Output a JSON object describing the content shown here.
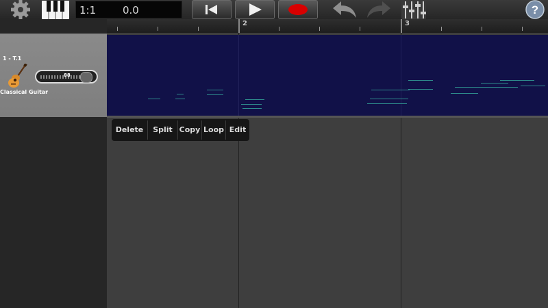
{
  "toolbar": {
    "position": "1:1",
    "time": "0.0",
    "buttons": [
      "settings-icon",
      "piano-keyboard-icon",
      "rewind-icon",
      "play-icon",
      "record-icon",
      "undo-icon",
      "redo-icon",
      "mixer-icon",
      "help-icon"
    ]
  },
  "ruler": {
    "bar_labels": [
      "2",
      "3"
    ]
  },
  "track": {
    "number": "1 - T.1",
    "instrument": "Classical Guitar",
    "instrument_icon": "guitar-icon",
    "volume": "88"
  },
  "context_menu": {
    "items": [
      "Delete",
      "Split",
      "Copy",
      "Loop",
      "Edit"
    ]
  },
  "colors": {
    "clip_background": "#111148",
    "note_color": "#2e8c8c",
    "record_red": "#d80000"
  }
}
